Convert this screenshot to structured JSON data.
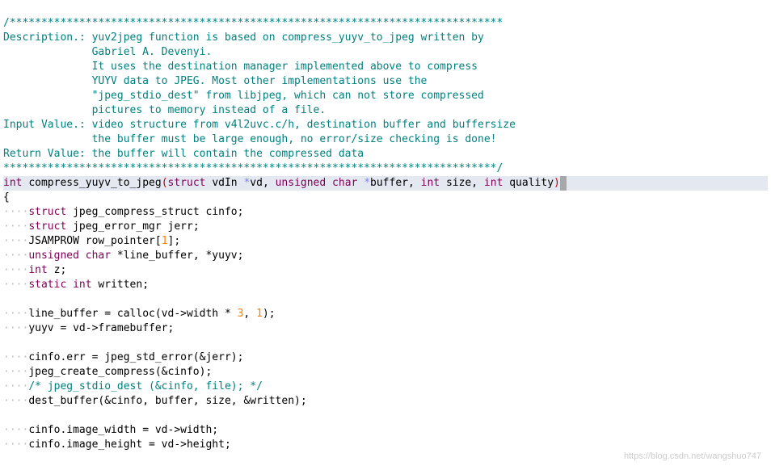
{
  "border": "/******************************************************************************",
  "d1": "Description.: yuv2jpeg function is based on compress_yuyv_to_jpeg written by",
  "d2": "              Gabriel A. Devenyi.",
  "d3": "              It uses the destination manager implemented above to compress",
  "d4": "              YUYV data to JPEG. Most other implementations use the",
  "d5": "              \"jpeg_stdio_dest\" from libjpeg, which can not store compressed",
  "d6": "              pictures to memory instead of a file.",
  "d7": "Input Value.: video structure from v4l2uvc.c/h, destination buffer and buffersize",
  "d8": "              the buffer must be large enough, no error/size checking is done!",
  "d9": "Return Value: the buffer will contain the compressed data",
  "border2": "******************************************************************************/",
  "sig": {
    "int": "int",
    "fn": "compress_yuyv_to_jpeg",
    "struct": "struct",
    "vdIn": "vdIn",
    "vd": "*vd",
    "comma": ", ",
    "unsigned": "unsigned",
    "char": "char",
    "buffer": "*buffer",
    "int2": "int",
    "size": "size",
    "int3": "int",
    "quality": "quality"
  },
  "l": {
    "brace": "{",
    "s1a": "struct",
    "s1b": "jpeg_compress_struct cinfo;",
    "s2a": "struct",
    "s2b": "jpeg_error_mgr jerr;",
    "s3": "JSAMPROW row_pointer[",
    "s3n": "1",
    "s3e": "];",
    "s4a": "unsigned",
    "s4b": "char",
    "s4c": "*line_buffer, *yuyv;",
    "s5a": "int",
    "s5b": "z;",
    "s6a": "static",
    "s6b": "int",
    "s6c": "written;",
    "s7": "line_buffer = calloc(vd->width * ",
    "s7n": "3",
    "s7m": ", ",
    "s7n2": "1",
    "s7e": ");",
    "s8": "yuyv = vd->framebuffer;",
    "s9": "cinfo.err = jpeg_std_error(&jerr);",
    "s10": "jpeg_create_compress(&cinfo);",
    "s11": "/* jpeg_stdio_dest (&cinfo, file); */",
    "s12": "dest_buffer(&cinfo, buffer, size, &written);",
    "s13": "cinfo.image_width = vd->width;",
    "s14": "cinfo.image_height = vd->height;"
  },
  "wm": "https://blog.csdn.net/wangshuo747"
}
